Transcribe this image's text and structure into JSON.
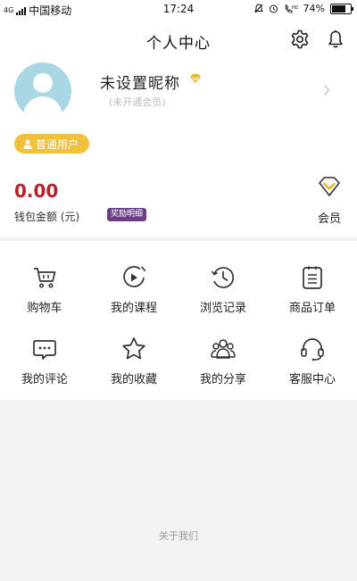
{
  "status_bar": {
    "network": "4G",
    "carrier": "中国移动",
    "time": "17:24",
    "battery_text": "74%",
    "battery_level": 0.74
  },
  "header": {
    "title": "个人中心"
  },
  "profile": {
    "nickname": "未设置昵称",
    "vip_status": "(未开通会员)",
    "user_type": "普通用户"
  },
  "wallet": {
    "amount": "0.00",
    "label": "钱包金额 (元)",
    "reward_tag": "奖励明细",
    "member_label": "会员"
  },
  "menu": {
    "items": [
      {
        "label": "购物车",
        "icon": "cart-icon"
      },
      {
        "label": "我的课程",
        "icon": "play-course-icon"
      },
      {
        "label": "浏览记录",
        "icon": "history-icon"
      },
      {
        "label": "商品订单",
        "icon": "order-icon"
      },
      {
        "label": "我的评论",
        "icon": "comment-icon"
      },
      {
        "label": "我的收藏",
        "icon": "star-icon"
      },
      {
        "label": "我的分享",
        "icon": "share-group-icon"
      },
      {
        "label": "客服中心",
        "icon": "headset-icon"
      }
    ]
  },
  "footer": {
    "about": "关于我们"
  },
  "colors": {
    "accent_yellow": "#f0c23c",
    "amount_red": "#b3232b",
    "reward_purple": "#6b3f86",
    "avatar_blue": "#a9d7e3"
  }
}
